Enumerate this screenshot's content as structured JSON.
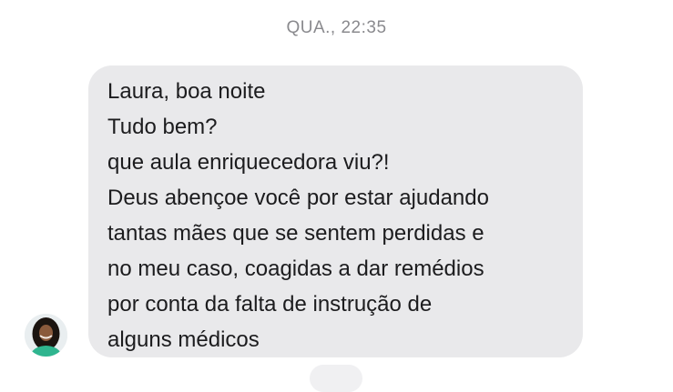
{
  "thread": {
    "timestamp": "QUA., 22:35"
  },
  "message": {
    "lines": [
      "Laura, boa noite",
      "Tudo bem?",
      "que aula enriquecedora viu?!",
      "Deus abençoe você por estar ajudando",
      "tantas mães que se sentem perdidas e",
      "no meu caso, coagidas a dar remédios",
      "por conta da falta de instrução de",
      "alguns médicos"
    ]
  },
  "sender": {
    "avatar_icon": "profile-photo",
    "avatar_colors": {
      "hair": "#1b1410",
      "skin": "#8a5a3c",
      "shirt": "#2fb58f",
      "background": "#e9eef0"
    }
  },
  "colors": {
    "bubble": "#e9e9eb",
    "text": "#1c1c1e",
    "timestamp": "#8a8a8e"
  }
}
